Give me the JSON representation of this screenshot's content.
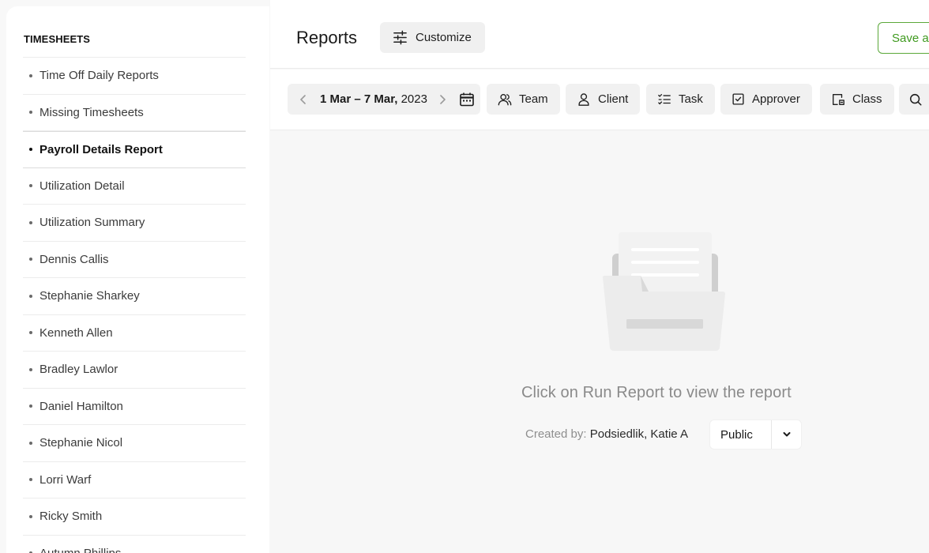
{
  "sidebar": {
    "title": "TIMESHEETS",
    "items": [
      {
        "label": "Time Off Daily Reports"
      },
      {
        "label": "Missing Timesheets"
      },
      {
        "label": "Payroll Details Report",
        "active": true
      },
      {
        "label": "Utilization Detail"
      },
      {
        "label": "Utilization Summary"
      },
      {
        "label": "Dennis Callis"
      },
      {
        "label": "Stephanie Sharkey"
      },
      {
        "label": "Kenneth Allen"
      },
      {
        "label": "Bradley Lawlor"
      },
      {
        "label": "Daniel Hamilton"
      },
      {
        "label": "Stephanie Nicol"
      },
      {
        "label": "Lorri Warf"
      },
      {
        "label": "Ricky Smith"
      },
      {
        "label": "Autumn Phillips"
      }
    ]
  },
  "header": {
    "title": "Reports",
    "customize_label": "Customize",
    "save_label": "Save as"
  },
  "filters": {
    "date_start": "1 Mar",
    "date_sep": " – ",
    "date_end": "7 Mar,",
    "date_year": " 2023",
    "chips": {
      "team": "Team",
      "client": "Client",
      "task": "Task",
      "approver": "Approver",
      "class": "Class"
    }
  },
  "main": {
    "empty_message": "Click on Run Report to view the report",
    "created_by_label": "Created by:",
    "created_by_name": "Podsiedlik, Katie A",
    "visibility": "Public"
  },
  "colors": {
    "accent_green": "#3f9a1f",
    "chip_bg": "#f1f1f1",
    "page_bg": "#f7f7f7"
  }
}
